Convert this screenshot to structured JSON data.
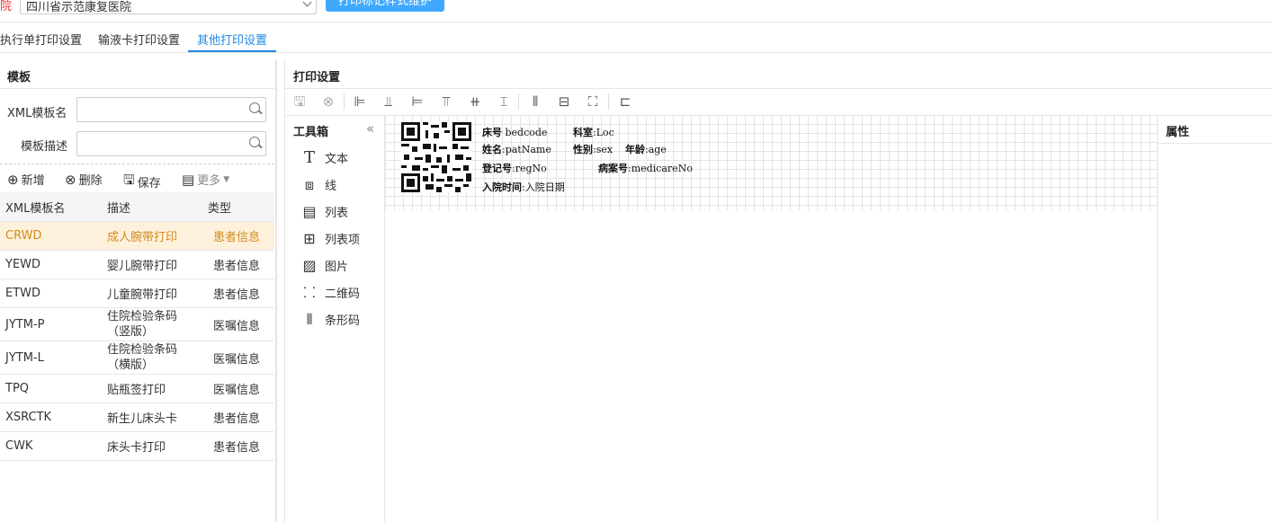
{
  "top": {
    "hospital_label": "院",
    "hospital_value": "四川省示范康复医院",
    "button_label": "打印标记样式维护"
  },
  "tabs": [
    {
      "label": "执行单打印设置",
      "active": false
    },
    {
      "label": "输液卡打印设置",
      "active": false
    },
    {
      "label": "其他打印设置",
      "active": true
    }
  ],
  "template_panel": {
    "title": "模板",
    "xml_name_label": "XML模板名",
    "xml_name_value": "",
    "desc_label": "模板描述",
    "desc_value": "",
    "toolbar": {
      "add": "新增",
      "delete": "删除",
      "save": "保存",
      "more": "更多"
    },
    "columns": [
      "XML模板名",
      "描述",
      "类型"
    ],
    "rows": [
      {
        "name": "CRWD",
        "desc": "成人腕带打印",
        "type": "患者信息",
        "selected": true
      },
      {
        "name": "YEWD",
        "desc": "婴儿腕带打印",
        "type": "患者信息"
      },
      {
        "name": "ETWD",
        "desc": "儿童腕带打印",
        "type": "患者信息"
      },
      {
        "name": "JYTM-P",
        "desc": "住院检验条码（竖版）",
        "type": "医嘱信息"
      },
      {
        "name": "JYTM-L",
        "desc": "住院检验条码（横版）",
        "type": "医嘱信息"
      },
      {
        "name": "TPQ",
        "desc": "贴瓶签打印",
        "type": "医嘱信息"
      },
      {
        "name": "XSRCTK",
        "desc": "新生儿床头卡",
        "type": "患者信息"
      },
      {
        "name": "CWK",
        "desc": "床头卡打印",
        "type": "患者信息"
      }
    ]
  },
  "print_settings": {
    "title": "打印设置",
    "toolbox_title": "工具箱",
    "tools": [
      {
        "icon": "text-icon",
        "label": "文本"
      },
      {
        "icon": "line-icon",
        "label": "线"
      },
      {
        "icon": "list-icon",
        "label": "列表"
      },
      {
        "icon": "table-icon",
        "label": "列表项"
      },
      {
        "icon": "image-icon",
        "label": "图片"
      },
      {
        "icon": "qrcode-icon",
        "label": "二维码"
      },
      {
        "icon": "barcode-icon",
        "label": "条形码"
      }
    ],
    "properties_title": "属性",
    "canvas": {
      "bed_label": "床号",
      "bed_value": "bedcode",
      "dept_label": "科室",
      "dept_value": ":Loc",
      "name_label": "姓名",
      "name_value": ":patName",
      "sex_label": "性别",
      "sex_value": ":sex",
      "age_label": "年龄",
      "age_value": ":age",
      "reg_label": "登记号",
      "reg_value": ":regNo",
      "mr_label": "病案号",
      "mr_value": ":medicareNo",
      "admit_label": "入院时间",
      "admit_value": ":入院日期"
    }
  }
}
